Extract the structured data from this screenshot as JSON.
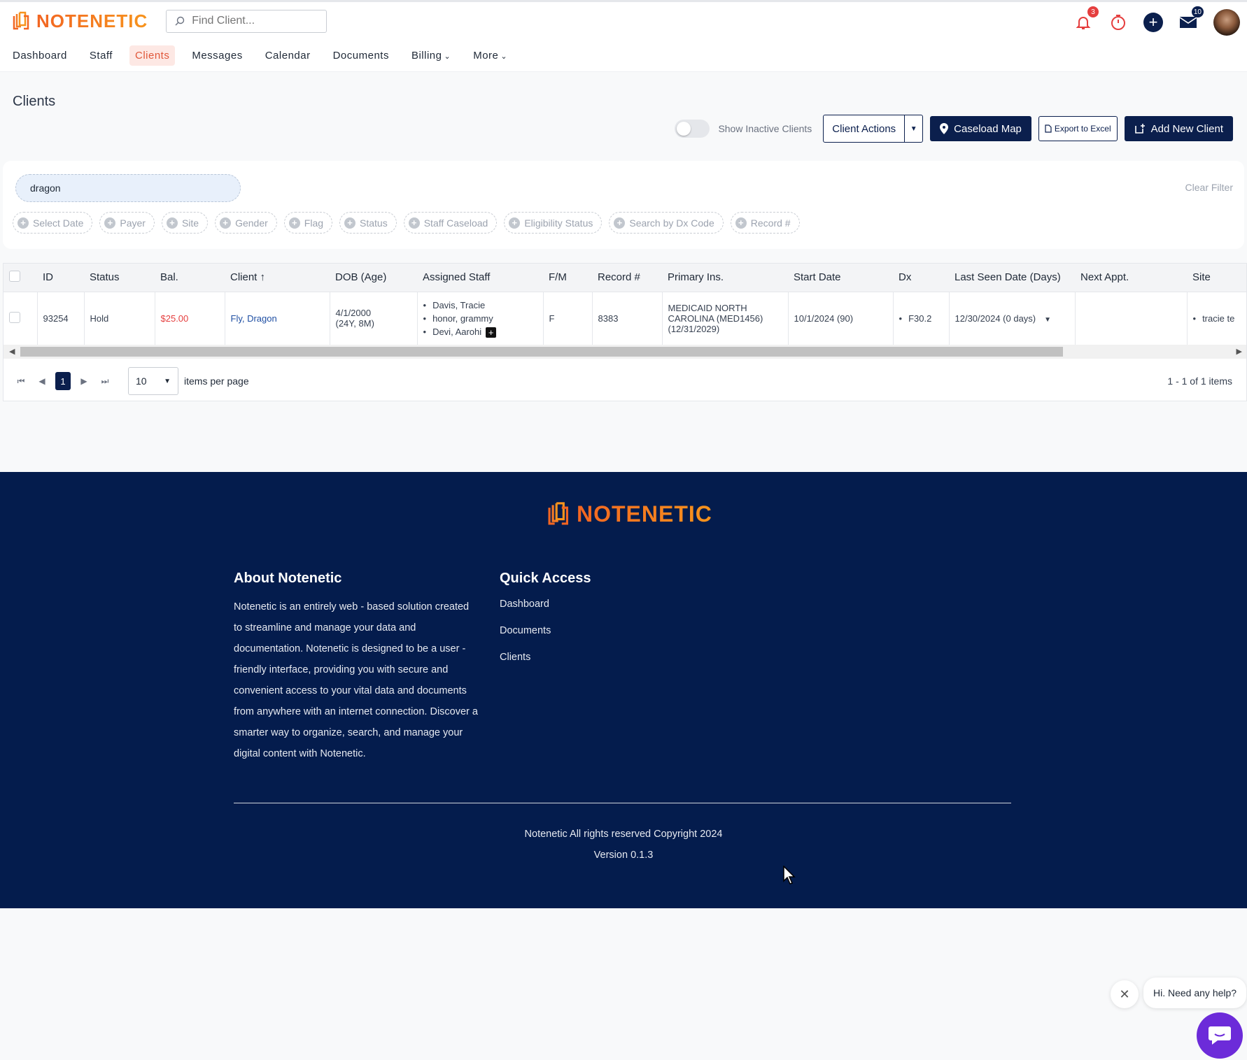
{
  "brand": {
    "name": "NOTENETIC",
    "accent": "#f26522",
    "navy": "#0b1f4d",
    "footer_bg": "#041c4d"
  },
  "search": {
    "placeholder": "Find Client..."
  },
  "top_icons": {
    "notifications_count": "3",
    "messages_count": "10"
  },
  "nav": {
    "dashboard": "Dashboard",
    "staff": "Staff",
    "clients": "Clients",
    "messages": "Messages",
    "calendar": "Calendar",
    "documents": "Documents",
    "billing": "Billing",
    "more": "More"
  },
  "page": {
    "title": "Clients"
  },
  "toolbar": {
    "show_inactive": "Show Inactive Clients",
    "client_actions": "Client Actions",
    "caseload_map": "Caseload Map",
    "export_excel": "Export to Excel",
    "add_client": "Add New Client"
  },
  "filter": {
    "search_value": "dragon",
    "clear": "Clear Filter",
    "chips": [
      "Select Date",
      "Payer",
      "Site",
      "Gender",
      "Flag",
      "Status",
      "Staff Caseload",
      "Eligibility Status",
      "Search by Dx Code",
      "Record #"
    ]
  },
  "table": {
    "headers": [
      "ID",
      "Status",
      "Bal.",
      "Client ↑",
      "DOB (Age)",
      "Assigned Staff",
      "F/M",
      "Record #",
      "Primary Ins.",
      "Start Date",
      "Dx",
      "Last Seen Date (Days)",
      "Next Appt.",
      "Site"
    ],
    "rows": [
      {
        "id": "93254",
        "status": "Hold",
        "balance": "$25.00",
        "client": "Fly, Dragon",
        "dob": "4/1/2000",
        "age": "(24Y, 8M)",
        "staff": [
          "Davis, Tracie",
          "honor, grammy",
          "Devi, Aarohi"
        ],
        "gender": "F",
        "record": "8383",
        "ins_line1": "MEDICAID NORTH",
        "ins_line2": "CAROLINA (MED1456)",
        "ins_line3": "(12/31/2029)",
        "start_date": "10/1/2024 (90)",
        "dx": "F30.2",
        "last_seen": "12/30/2024 (0 days)",
        "next_appt": "",
        "site": "tracie te"
      }
    ]
  },
  "pager": {
    "current": "1",
    "page_size": "10",
    "items_label": "items per page",
    "info": "1 - 1 of 1 items"
  },
  "footer": {
    "about_title": "About Notenetic",
    "about_text": "Notenetic is an entirely web - based solution created to streamline and manage your data and documentation. Notenetic is designed to be a user - friendly interface, providing you with secure and convenient access to your vital data and documents from anywhere with an internet connection. Discover a smarter way to organize, search, and manage your digital content with Notenetic.",
    "quick_title": "Quick Access",
    "quick_links": [
      "Dashboard",
      "Documents",
      "Clients"
    ],
    "copyright": "Notenetic All rights reserved Copyright 2024",
    "version": "Version 0.1.3"
  },
  "help": {
    "bubble": "Hi. Need any help?"
  }
}
